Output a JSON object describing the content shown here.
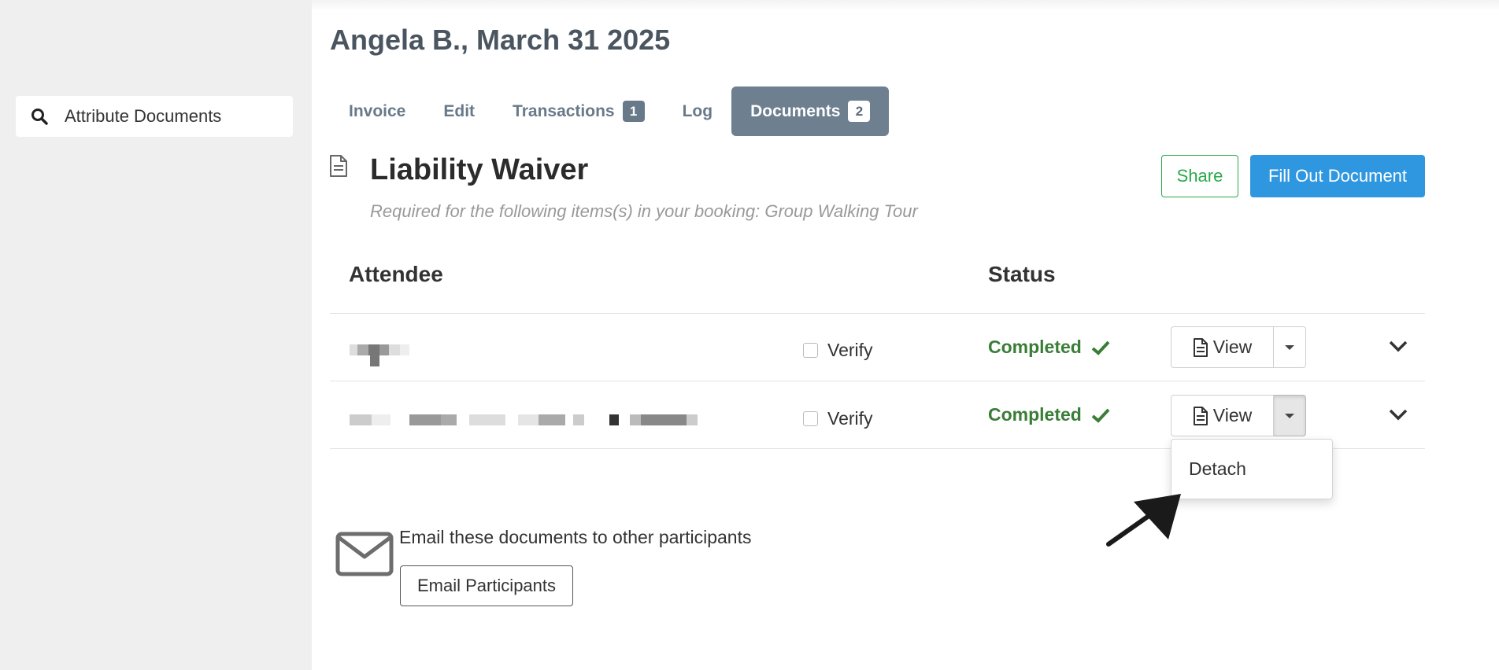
{
  "sidebar": {
    "search_label": "Attribute Documents",
    "search_icon": "search-icon"
  },
  "header": {
    "title": "Angela B., March 31 2025"
  },
  "tabs": [
    {
      "label": "Invoice",
      "count": null,
      "active": false
    },
    {
      "label": "Edit",
      "count": null,
      "active": false
    },
    {
      "label": "Transactions",
      "count": "1",
      "active": false
    },
    {
      "label": "Log",
      "count": null,
      "active": false
    },
    {
      "label": "Documents",
      "count": "2",
      "active": true
    }
  ],
  "document": {
    "icon": "document-icon",
    "title": "Liability Waiver",
    "subtitle": "Required for the following items(s) in your booking: Group Walking Tour",
    "share_label": "Share",
    "fill_label": "Fill Out Document"
  },
  "table": {
    "headers": {
      "attendee": "Attendee",
      "status": "Status"
    },
    "rows": [
      {
        "verify_label": "Verify",
        "status": "Completed",
        "view_label": "View",
        "dropdown_open": false
      },
      {
        "verify_label": "Verify",
        "status": "Completed",
        "view_label": "View",
        "dropdown_open": true
      }
    ]
  },
  "dropdown": {
    "items": [
      "Detach"
    ]
  },
  "email": {
    "text": "Email these documents to other participants",
    "button_label": "Email Participants",
    "icon": "envelope-icon"
  },
  "colors": {
    "tab_active_bg": "#6e7f90",
    "status_green": "#3a7d36",
    "share_green": "#2aa84a",
    "primary_blue": "#2f97e0"
  }
}
